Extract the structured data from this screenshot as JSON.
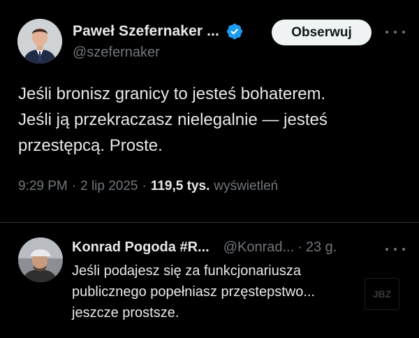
{
  "tweet": {
    "author_name": "Paweł Szefernaker ...",
    "author_handle": "@szefernaker",
    "follow_label": "Obserwuj",
    "verified_icon": "verified-badge-icon",
    "text_lines": [
      "Jeśli bronisz granicy to jesteś bohaterem.",
      "Jeśli ją przekraczasz nielegalnie — jesteś",
      "przestępcą. Proste."
    ],
    "time": "9:29 PM",
    "date": "2 lip 2025",
    "views_count": "119,5 tys.",
    "views_label": "wyświetleń",
    "separator": "·"
  },
  "reply": {
    "author_name": "Konrad Pogoda #R...",
    "author_handle": "@Konrad...",
    "time": "23 g.",
    "separator": "·",
    "text_lines": [
      "Jeśli podajesz się za funkcjonariusza",
      "publicznego popełniasz przęstepstwo...",
      "jeszcze prostsze."
    ]
  },
  "watermark": {
    "text": "JBZ"
  },
  "colors": {
    "background": "#000000",
    "text_primary": "#e7e9ea",
    "text_secondary": "#71767b",
    "verified_blue": "#1d9bf0",
    "button_bg": "#eff3f4",
    "divider": "#2f3336"
  }
}
